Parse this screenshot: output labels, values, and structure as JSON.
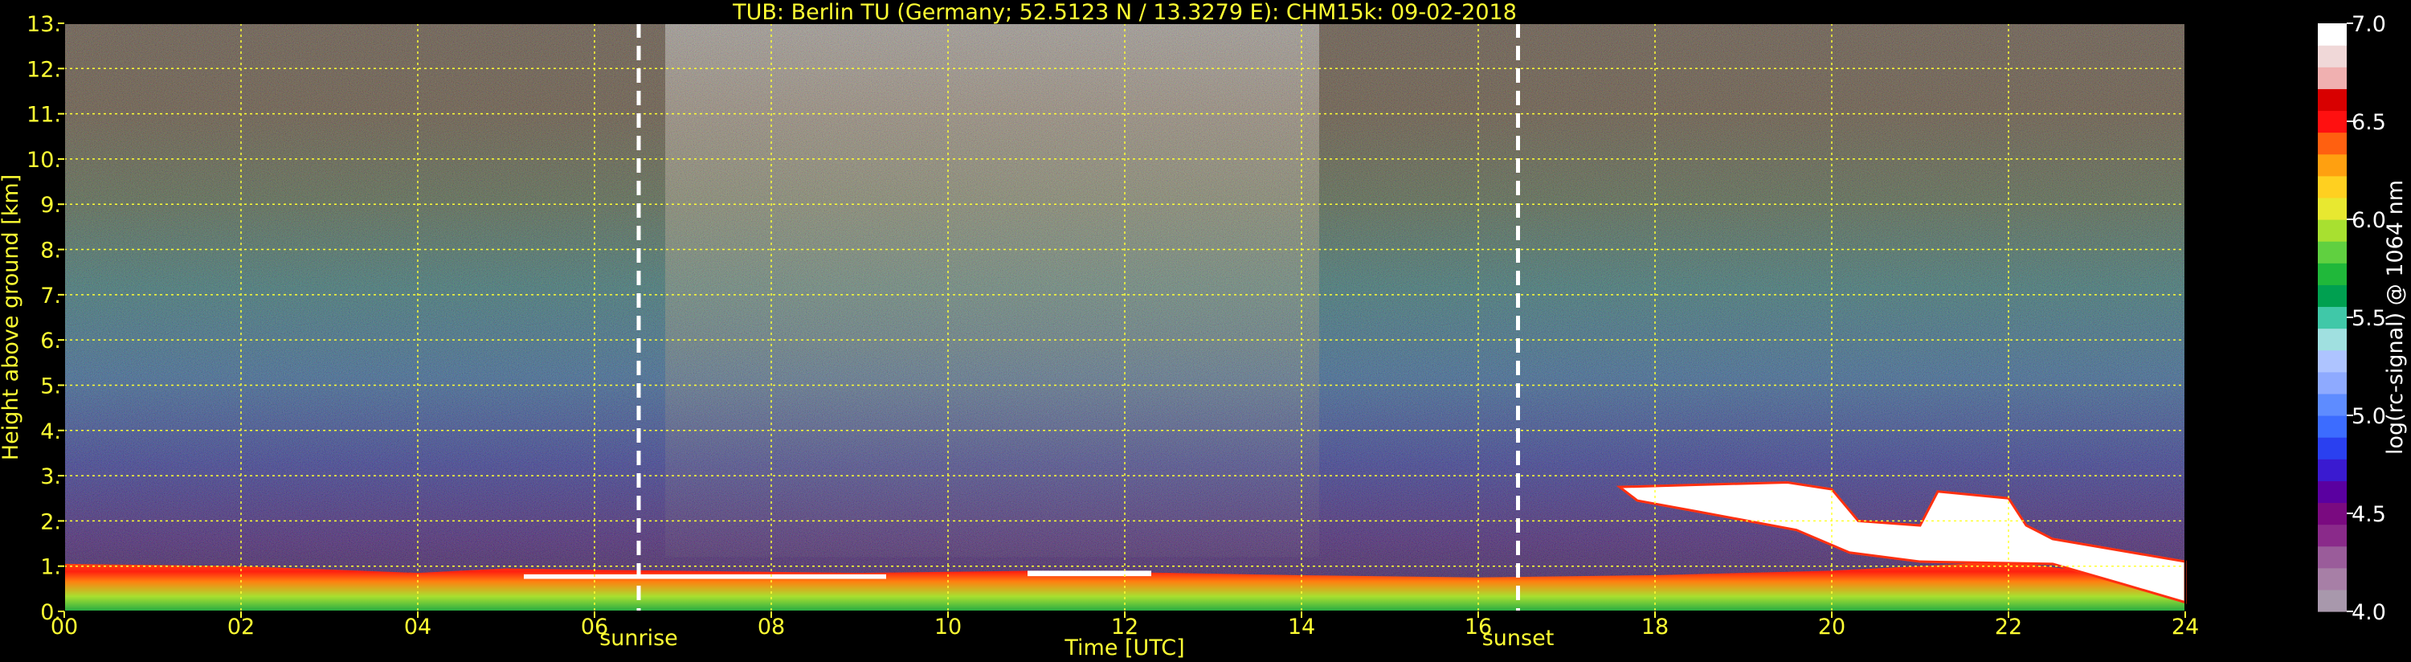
{
  "chart_data": {
    "type": "heatmap",
    "title": "TUB: Berlin TU (Germany; 52.5123 N / 13.3279 E):    CHM15k: 09-02-2018",
    "xlabel": "Time [UTC]",
    "ylabel": "Height above ground [km]",
    "xlim": [
      0,
      24
    ],
    "ylim": [
      0,
      13
    ],
    "x_ticks": [
      0,
      2,
      4,
      6,
      8,
      10,
      12,
      14,
      16,
      18,
      20,
      22,
      24
    ],
    "x_tick_labels": [
      "00",
      "02",
      "04",
      "06",
      "08",
      "10",
      "12",
      "14",
      "16",
      "18",
      "20",
      "22",
      "24"
    ],
    "y_ticks": [
      0,
      1,
      2,
      3,
      4,
      5,
      6,
      7,
      8,
      9,
      10,
      11,
      12,
      13
    ],
    "y_tick_labels": [
      "0.",
      "1.",
      "2.",
      "3.",
      "4.",
      "5.",
      "6.",
      "7.",
      "8.",
      "9.",
      "10.",
      "11.",
      "12.",
      "13."
    ],
    "grid": true,
    "events": [
      {
        "label": "sunrise",
        "time": 6.5
      },
      {
        "label": "sunset",
        "time": 16.45
      }
    ],
    "colorbar": {
      "label": "log(rc-signal) @ 1064 nm",
      "range": [
        4.0,
        7.0
      ],
      "ticks": [
        4.0,
        4.5,
        5.0,
        5.5,
        6.0,
        6.5,
        7.0
      ],
      "tick_labels": [
        "4.0",
        "4.5",
        "5.0",
        "5.5",
        "6.0",
        "6.5",
        "7.0"
      ],
      "colors": [
        "#a898ac",
        "#a77fa6",
        "#9a5c9a",
        "#8a2a8a",
        "#7a0a80",
        "#5a00a0",
        "#3a1ad0",
        "#2a40f0",
        "#3c6cff",
        "#5e8cff",
        "#8eaaff",
        "#aec4ff",
        "#a0e0e0",
        "#40c8a8",
        "#00a050",
        "#20b83a",
        "#60d040",
        "#a8e030",
        "#e8e830",
        "#ffd020",
        "#ffa010",
        "#ff6010",
        "#ff1010",
        "#d80000",
        "#f0b0b0",
        "#f0d8d8",
        "#ffffff"
      ]
    },
    "features": [
      {
        "name": "boundary layer aerosol",
        "x_range": [
          0,
          24
        ],
        "y_range": [
          0,
          1.1
        ]
      },
      {
        "name": "cloud",
        "x_range": [
          17.6,
          22.4
        ],
        "y_range": [
          1.0,
          2.8
        ]
      }
    ]
  },
  "colors": {
    "background": "#000000",
    "text": "#ffff33",
    "grid": "#ffff33",
    "event_line": "#ffffff",
    "colorbar_text": "#ffffff"
  }
}
